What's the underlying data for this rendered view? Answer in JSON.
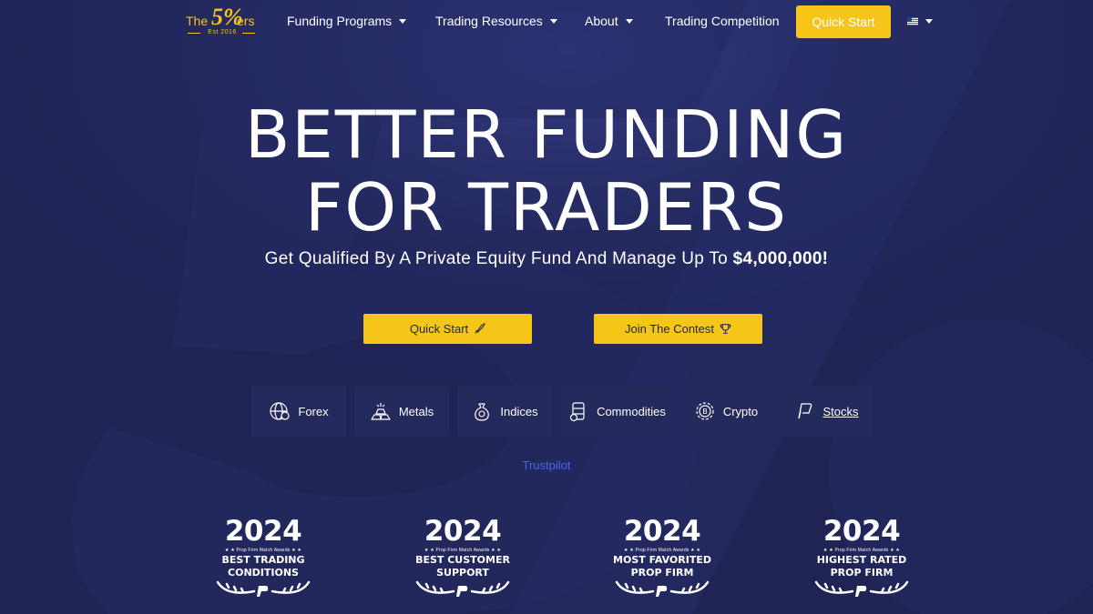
{
  "brand": {
    "logo_the": "The",
    "logo_five": "5%",
    "logo_ers": "ers",
    "logo_est": "Est 2016",
    "accent_color": "#f5c518",
    "background_color": "#1f2455"
  },
  "nav": {
    "items": [
      {
        "label": "Funding Programs",
        "has_dropdown": true
      },
      {
        "label": "Trading Resources",
        "has_dropdown": true
      },
      {
        "label": "About",
        "has_dropdown": true
      },
      {
        "label": "Trading Competition",
        "has_dropdown": false
      }
    ],
    "cta_label": "Quick Start",
    "language_icon": "us-flag-icon"
  },
  "hero": {
    "title_line1": "BETTER FUNDING",
    "title_line2": "FOR TRADERS",
    "subtitle_prefix": "Get Qualified By A Private Equity Fund And Manage Up To ",
    "subtitle_amount": "$4,000,000!",
    "buttons": [
      {
        "label": "Quick Start",
        "icon": "rocket-icon"
      },
      {
        "label": "Join The Contest",
        "icon": "trophy-icon"
      }
    ]
  },
  "markets": [
    {
      "label": "Forex",
      "icon": "globe-currency-icon"
    },
    {
      "label": "Metals",
      "icon": "gold-bars-icon"
    },
    {
      "label": "Indices",
      "icon": "money-bag-icon"
    },
    {
      "label": "Commodities",
      "icon": "oil-barrel-icon"
    },
    {
      "label": "Crypto",
      "icon": "bitcoin-icon"
    },
    {
      "label": "Stocks",
      "icon": "stocks-icon"
    }
  ],
  "trustpilot_label": "Trustpilot",
  "awards": [
    {
      "year": "2024",
      "small": "★ ★ Prop Firm Match Awards ★ ★",
      "line1": "BEST TRADING",
      "line2": "CONDITIONS"
    },
    {
      "year": "2024",
      "small": "★ ★ Prop Firm Match Awards ★ ★",
      "line1": "BEST CUSTOMER",
      "line2": "SUPPORT"
    },
    {
      "year": "2024",
      "small": "★ ★ Prop Firm Match Awards ★ ★",
      "line1": "MOST FAVORITED",
      "line2": "PROP FIRM"
    },
    {
      "year": "2024",
      "small": "★ ★ Prop Firm Match Awards ★ ★",
      "line1": "HIGHEST RATED",
      "line2": "PROP FIRM"
    }
  ]
}
